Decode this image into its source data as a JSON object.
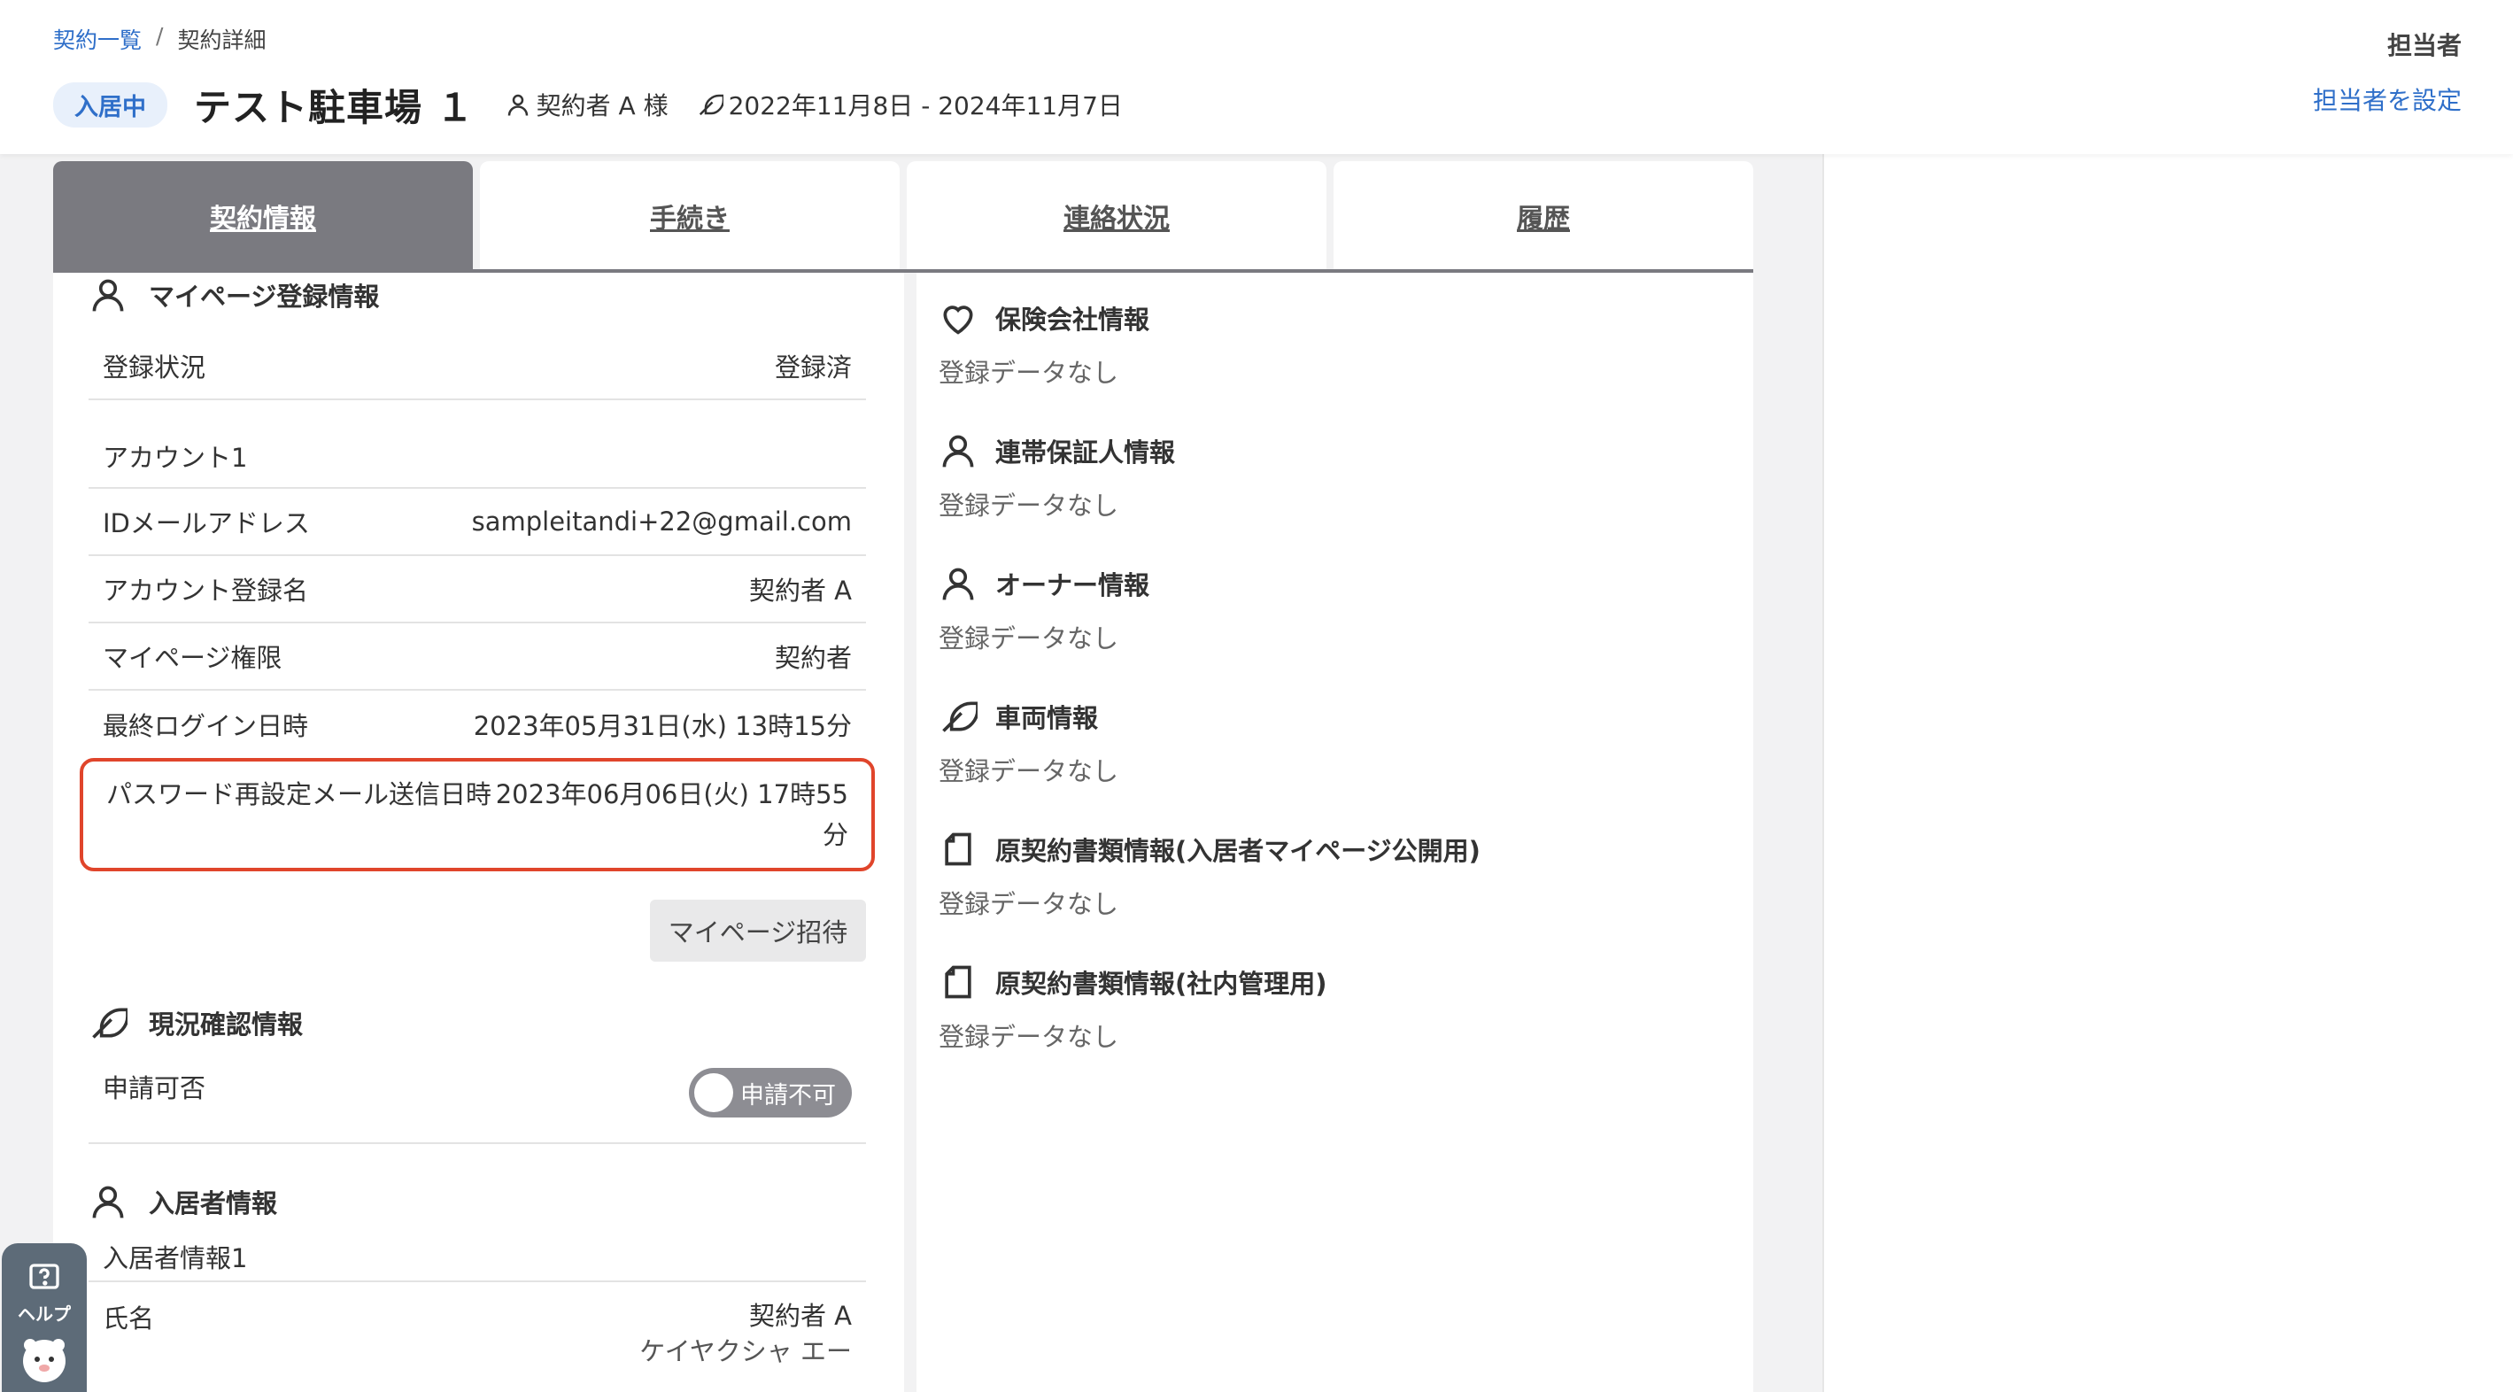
{
  "breadcrumb": {
    "link": "契約一覧",
    "separator": "/",
    "current": "契約詳細"
  },
  "header": {
    "status": "入居中",
    "title": "テスト駐車場 １",
    "contractor": "契約者 A 様",
    "period": "2022年11月8日 - 2024年11月7日",
    "assignee_label": "担当者",
    "assignee_link": "担当者を設定"
  },
  "tabs": [
    {
      "label": "契約情報",
      "active": true
    },
    {
      "label": "手続き",
      "active": false
    },
    {
      "label": "連絡状況",
      "active": false
    },
    {
      "label": "履歴",
      "active": false
    }
  ],
  "mypage": {
    "title": "マイページ登録情報",
    "status_label": "登録状況",
    "status_value": "登録済",
    "account_label": "アカウント1",
    "rows": [
      {
        "k": "IDメールアドレス",
        "v": "sampleitandi+22@gmail.com"
      },
      {
        "k": "アカウント登録名",
        "v": "契約者 A"
      },
      {
        "k": "マイページ権限",
        "v": "契約者"
      },
      {
        "k": "最終ログイン日時",
        "v": "2023年05月31日(水) 13時15分"
      }
    ],
    "password_reset_label": "パスワード再設定メール送信日時",
    "password_reset_value": "2023年06月06日(火) 17時55分",
    "invite_button": "マイページ招待"
  },
  "status_check": {
    "title": "現況確認情報",
    "apply_label": "申請可否",
    "toggle_label": "申請不可"
  },
  "resident": {
    "title": "入居者情報",
    "sub": "入居者情報1",
    "name_label": "氏名",
    "name_value": "契約者 A",
    "kana_value": "ケイヤクシャ エー"
  },
  "right_sections": {
    "empty_text": "登録データなし",
    "insurance": "保険会社情報",
    "guarantor": "連帯保証人情報",
    "owner": "オーナー情報",
    "vehicle": "車両情報",
    "original_docs_public": "原契約書類情報(入居者マイページ公開用)",
    "original_docs_internal": "原契約書類情報(社内管理用)"
  },
  "help": {
    "label": "ヘルプ"
  },
  "colors": {
    "accent": "#2f6fc9",
    "tab_active": "#7a7a80",
    "highlight": "#e0452b"
  }
}
